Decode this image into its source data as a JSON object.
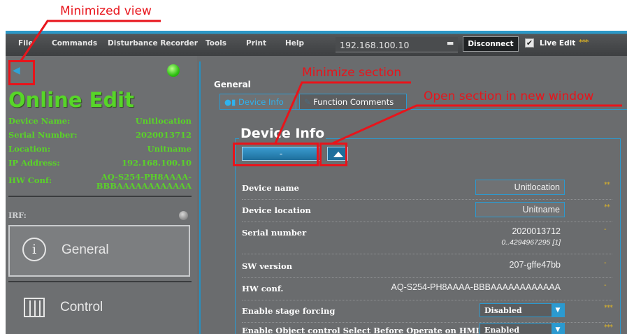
{
  "annotations": {
    "minimized_view": "Minimized view",
    "minimize_section": "Minimize section",
    "open_section_new_window": "Open section in new window"
  },
  "menu": {
    "file": "File",
    "commands": "Commands",
    "disturbance_recorder": "Disturbance Recorder",
    "tools": "Tools",
    "print": "Print",
    "help": "Help"
  },
  "connection": {
    "ip": "192.168.100.10",
    "disconnect_label": "Disconnect",
    "live_edit_checked": "✔",
    "live_edit_label": "Live Edit",
    "live_edit_level": "***"
  },
  "left_panel": {
    "minimize_icon": "◀",
    "status_title": "Online Edit",
    "device_name_label": "Device Name:",
    "device_name": "Unitlocation",
    "serial_label": "Serial Number:",
    "serial": "2020013712",
    "location_label": "Location:",
    "location": "Unitname",
    "ip_label": "IP Address:",
    "ip": "192.168.100.10",
    "hw_label": "HW Conf:",
    "hw_line1": "AQ-S254-PH8AAAA-",
    "hw_line2": "BBBAAAAAAAAAAAA",
    "irf_label": "IRF:",
    "nav_general": "General",
    "nav_control": "Control"
  },
  "main": {
    "section_title": "General",
    "tabs": [
      "Device Info",
      "Function Comments"
    ],
    "group_title": "Device Info",
    "collapse_label": "-",
    "rows": {
      "device_name": {
        "label": "Device name",
        "value": "Unitlocation",
        "level": "**"
      },
      "device_location": {
        "label": "Device location",
        "value": "Unitname",
        "level": "**"
      },
      "serial_number": {
        "label": "Serial number",
        "value": "2020013712",
        "range": "0..4294967295 [1]",
        "level": "-"
      },
      "sw_version": {
        "label": "SW version",
        "value": "207-gffe47bb",
        "level": "-"
      },
      "hw_conf": {
        "label": "HW conf.",
        "value": "AQ-S254-PH8AAAA-BBBAAAAAAAAAAAA",
        "level": "-"
      },
      "stage_forcing": {
        "label": "Enable stage forcing",
        "value": "Disabled",
        "level": "***"
      },
      "object_control": {
        "label": "Enable Object control Select Before Operate on HMI",
        "value": "Enabled",
        "level": "***"
      }
    }
  },
  "colors": {
    "annotation_red": "#e8141b",
    "accent_blue": "#2b9ad0",
    "online_green": "#57d628",
    "level_gold": "#d9b22a"
  }
}
